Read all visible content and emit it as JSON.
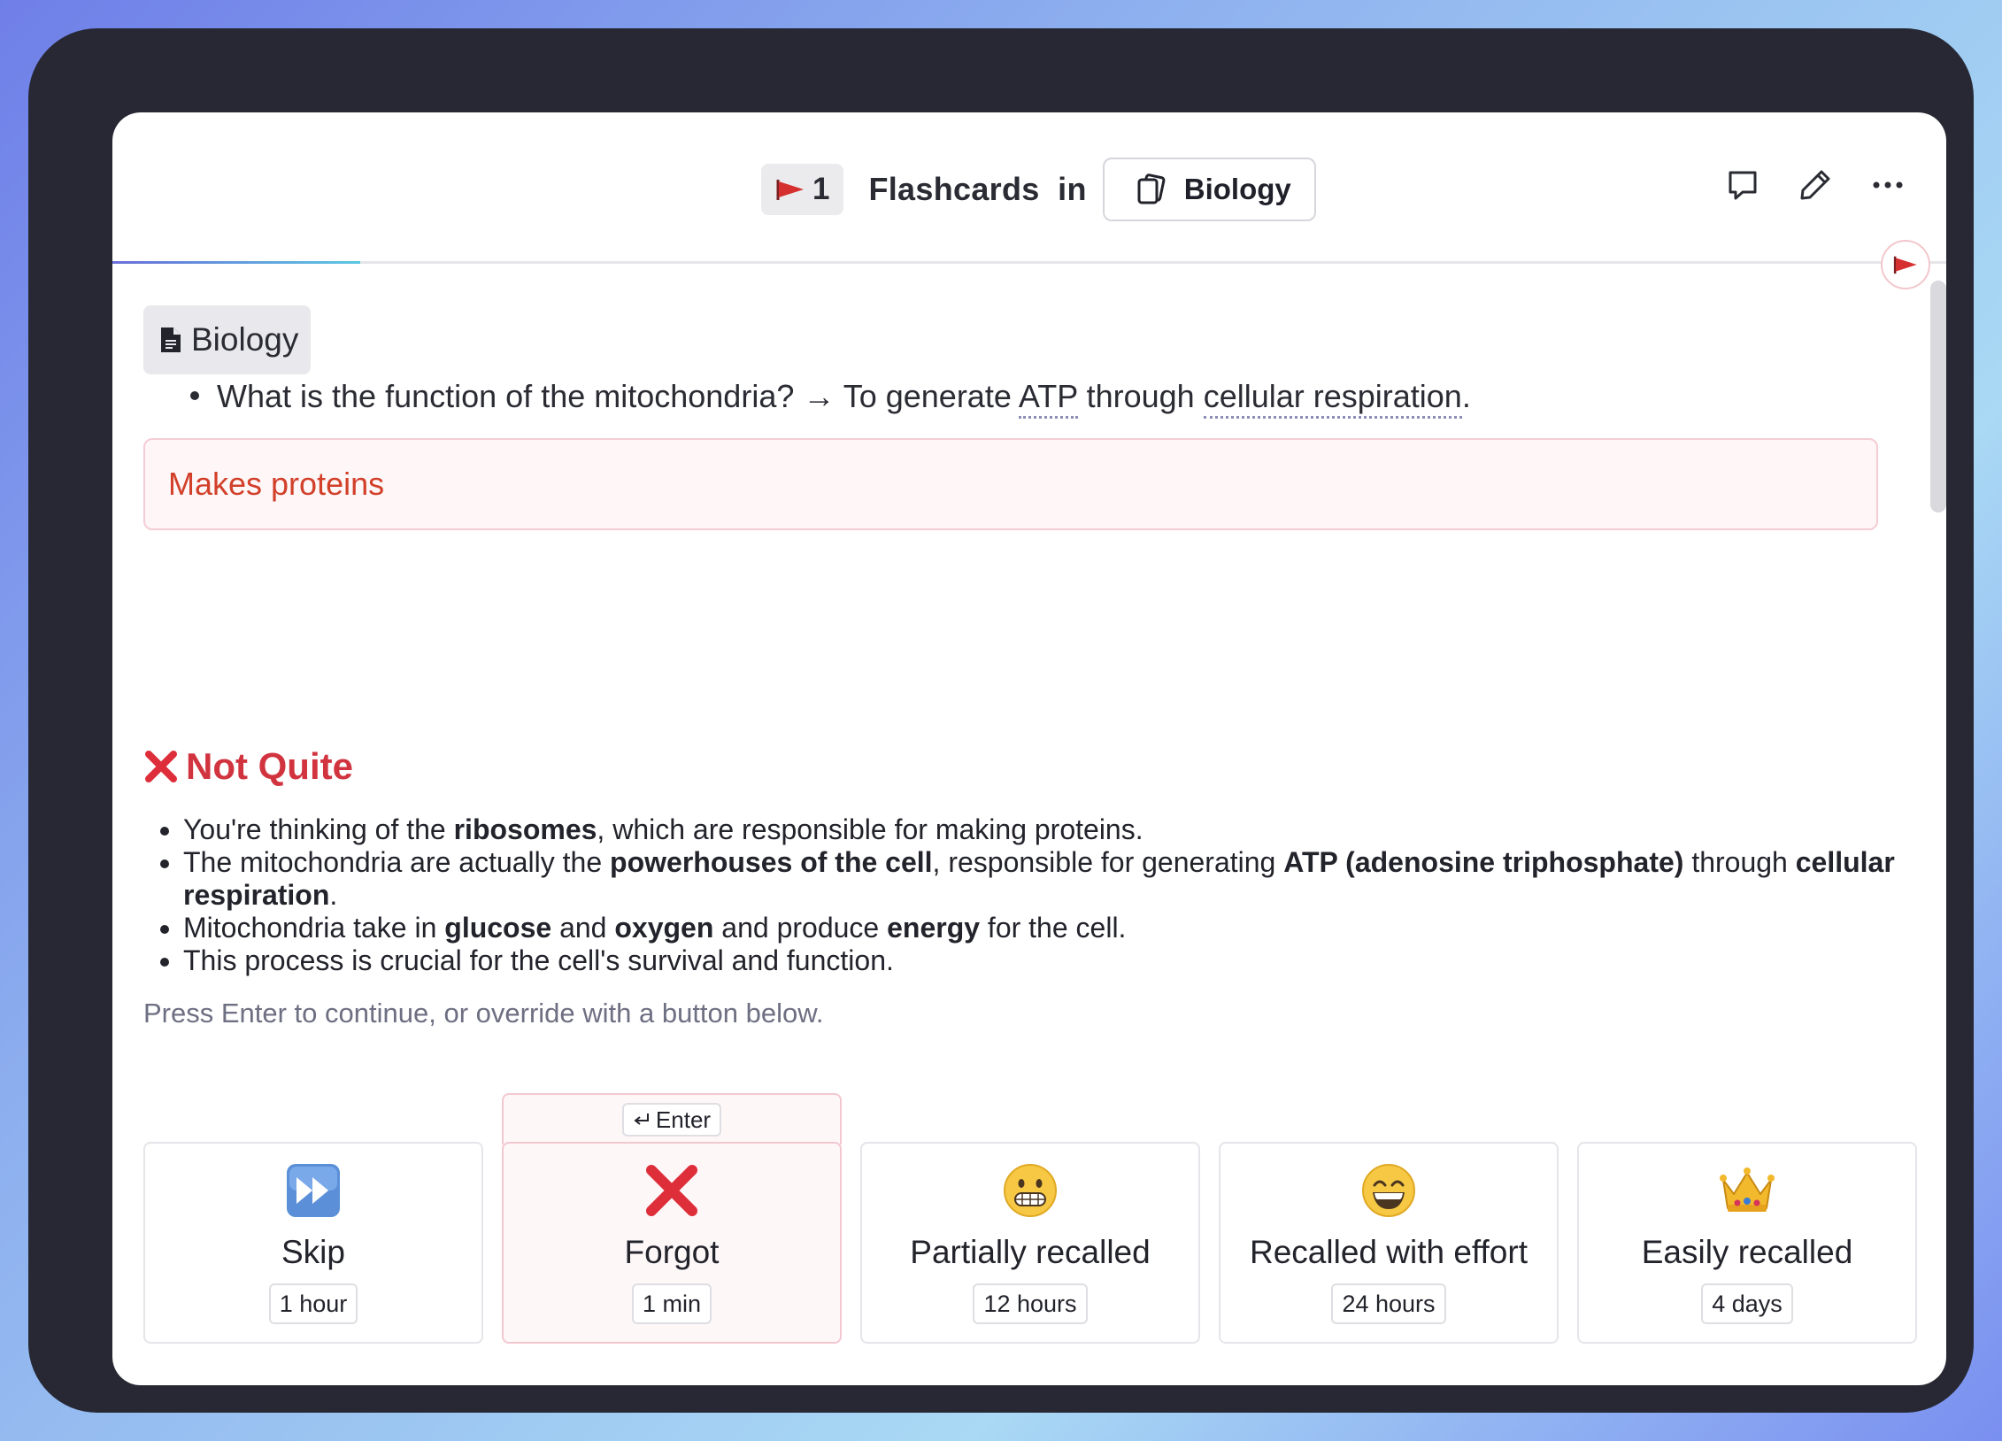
{
  "header": {
    "flag_count": "1",
    "title": "Flashcards  in",
    "deck_name": "Biology",
    "actions": [
      "comment-icon",
      "pencil-icon",
      "more-icon"
    ]
  },
  "progress": {
    "fraction": 0.135
  },
  "card": {
    "source_chip": "Biology",
    "question": "What is the function of the mitochondria? → To generate ",
    "term1": "ATP",
    "question_mid": " through ",
    "term2": "cellular respiration",
    "question_end": ".",
    "user_answer": "Makes proteins"
  },
  "feedback": {
    "verdict": "Not Quite",
    "points": [
      {
        "parts": [
          [
            "You're thinking of the ",
            false
          ],
          [
            "ribosomes",
            true
          ],
          [
            ", which are responsible for making proteins.",
            false
          ]
        ]
      },
      {
        "parts": [
          [
            "The mitochondria are actually the ",
            false
          ],
          [
            "powerhouses of the cell",
            true
          ],
          [
            ", responsible for generating ",
            false
          ],
          [
            "ATP (adenosine triphosphate)",
            true
          ],
          [
            " through ",
            false
          ],
          [
            "cellular respiration",
            true
          ],
          [
            ".",
            false
          ]
        ]
      },
      {
        "parts": [
          [
            "Mitochondria take in ",
            false
          ],
          [
            "glucose",
            true
          ],
          [
            " and ",
            false
          ],
          [
            "oxygen",
            true
          ],
          [
            " and produce ",
            false
          ],
          [
            "energy",
            true
          ],
          [
            " for the cell.",
            false
          ]
        ]
      },
      {
        "parts": [
          [
            "This process is crucial for the cell's survival and function.",
            false
          ]
        ]
      }
    ],
    "hint": "Press Enter to continue, or override with a button below."
  },
  "ratings": {
    "enter_label": "Enter",
    "buttons": [
      {
        "label": "Skip",
        "interval": "1 hour",
        "icon": "fast-forward-icon"
      },
      {
        "label": "Forgot",
        "interval": "1 min",
        "icon": "cross-mark-icon"
      },
      {
        "label": "Partially recalled",
        "interval": "12 hours",
        "icon": "grimacing-face-icon"
      },
      {
        "label": "Recalled with effort",
        "interval": "24 hours",
        "icon": "grinning-face-icon"
      },
      {
        "label": "Easily recalled",
        "interval": "4 days",
        "icon": "crown-icon"
      }
    ]
  },
  "colors": {
    "accent_red": "#d1343f",
    "answer_red": "#d2402a",
    "progress_start": "#6a6fd8",
    "progress_end": "#5cc6e2"
  }
}
